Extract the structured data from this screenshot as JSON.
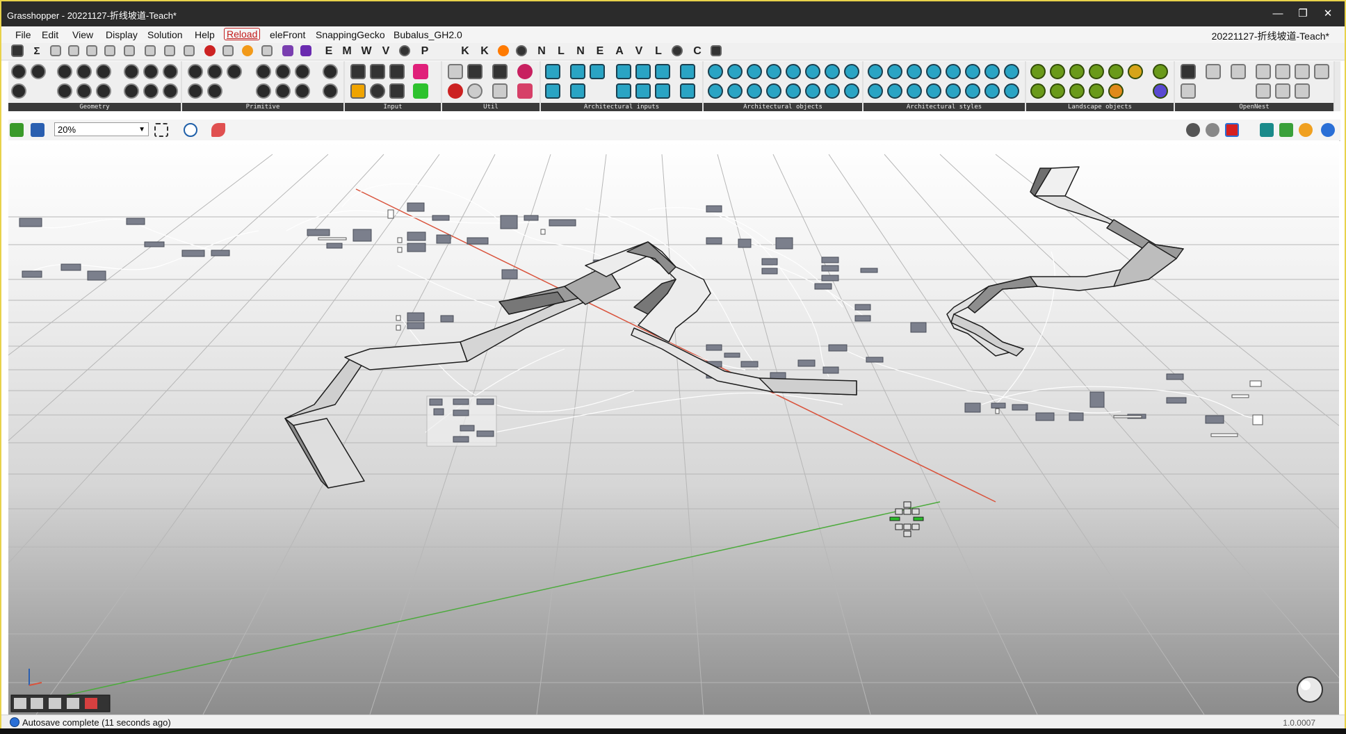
{
  "window": {
    "title": "Grasshopper - 20221127-折线坡道-Teach*",
    "controls": [
      "—",
      "❐",
      "✕"
    ]
  },
  "menubar": {
    "items": [
      "File",
      "Edit",
      "View",
      "Display",
      "Solution",
      "Help",
      "Reload",
      "eleFront",
      "SnappingGecko",
      "Bubalus_GH2.0"
    ],
    "document_name": "20221127-折线坡道-Teach*"
  },
  "letter_tabs": [
    "E",
    "M",
    "W",
    "V",
    "P",
    "K",
    "K",
    "N",
    "L",
    "N",
    "E",
    "A",
    "V",
    "L",
    "C"
  ],
  "ribbon": {
    "groups": [
      "Geometry",
      "Primitive",
      "Input",
      "Util",
      "Architectural inputs",
      "Architectural objects",
      "Architectural styles",
      "Landscape objects",
      "OpenNest"
    ]
  },
  "canvas_toolbar": {
    "zoom": "20%"
  },
  "status": {
    "message": "Autosave complete (11 seconds ago)",
    "version": "1.0.0007"
  },
  "colors": {
    "title_bar": "#2b2b2b",
    "window_border": "#e8d24a",
    "x_axis": "#d9533c",
    "y_axis": "#4caa3c",
    "component_fill": "#7b7f8c"
  },
  "icons": [
    "new-file-icon",
    "save-icon",
    "zoom-extents-icon",
    "preview-eye-icon",
    "sketch-pen-icon",
    "gizmo-icon",
    "navigation-orb-icon"
  ]
}
